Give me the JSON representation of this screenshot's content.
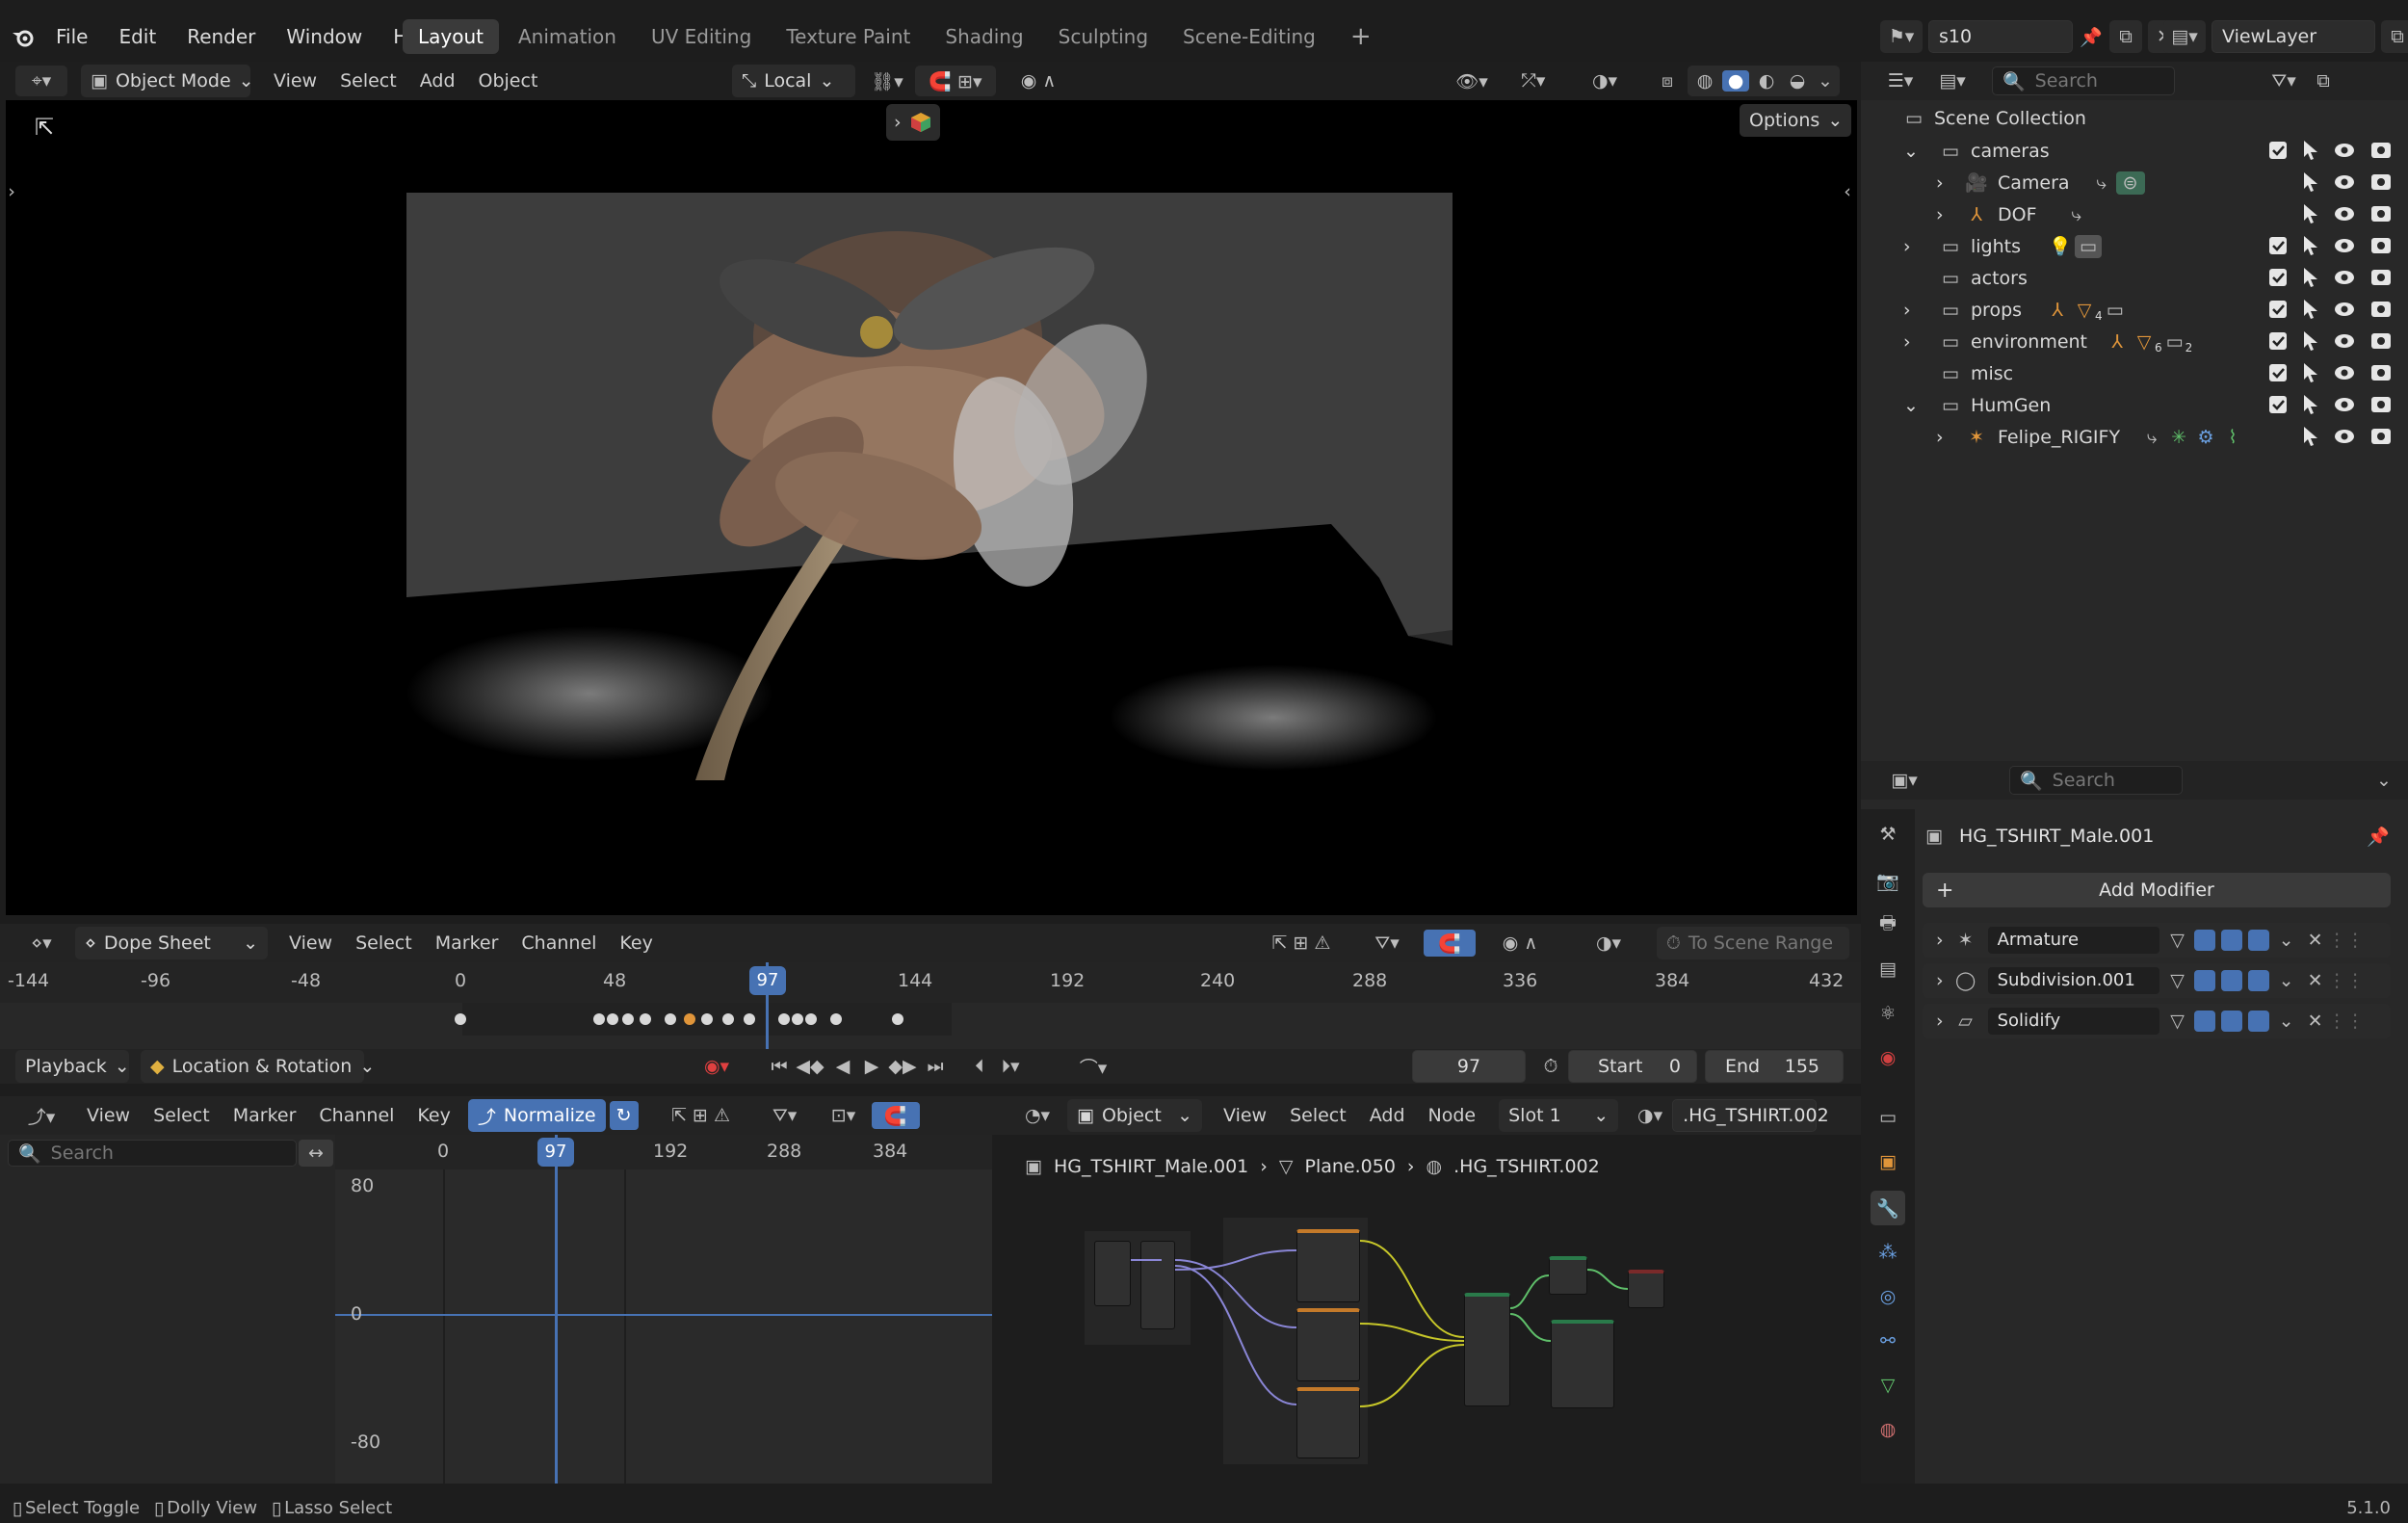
{
  "app": {
    "version": "5.1.0"
  },
  "top_menu": [
    "File",
    "Edit",
    "Render",
    "Window",
    "Help"
  ],
  "workspaces": [
    "Layout",
    "Animation",
    "UV Editing",
    "Texture Paint",
    "Shading",
    "Sculpting",
    "Scene-Editing"
  ],
  "scene": {
    "name": "s10",
    "view_layer": "ViewLayer"
  },
  "viewport": {
    "mode": "Object Mode",
    "menus": [
      "View",
      "Select",
      "Add",
      "Object"
    ],
    "transform_orientation": "Local",
    "options_label": "Options"
  },
  "outliner": {
    "search_placeholder": "Search",
    "root": "Scene Collection",
    "items": [
      {
        "label": "cameras"
      },
      {
        "label": "Camera"
      },
      {
        "label": "DOF"
      },
      {
        "label": "lights"
      },
      {
        "label": "actors"
      },
      {
        "label": "props"
      },
      {
        "label": "environment"
      },
      {
        "label": "misc"
      },
      {
        "label": "HumGen"
      },
      {
        "label": "Felipe_RIGIFY"
      }
    ],
    "badges": {
      "props_count": "4",
      "environment_count": "6",
      "environment_count2": "2"
    }
  },
  "properties": {
    "search_placeholder": "Search",
    "object_name": "HG_TSHIRT_Male.001",
    "add_modifier": "Add Modifier",
    "modifiers": [
      "Armature",
      "Subdivision.001",
      "Solidify"
    ]
  },
  "dopesheet": {
    "editor": "Dope Sheet",
    "menus": [
      "View",
      "Select",
      "Marker",
      "Channel",
      "Key"
    ],
    "scene_range": "To Scene Range",
    "ruler": [
      "-144",
      "-96",
      "-48",
      "0",
      "48",
      "97",
      "144",
      "192",
      "240",
      "288",
      "336",
      "384",
      "432"
    ],
    "current_frame_marker": "97"
  },
  "playback": {
    "playback_label": "Playback",
    "keying_set": "Location & Rotation",
    "current_frame": "97",
    "start_label": "Start",
    "start": "0",
    "end_label": "End",
    "end": "155"
  },
  "graph": {
    "menus": [
      "View",
      "Select",
      "Marker",
      "Channel",
      "Key"
    ],
    "normalize": "Normalize",
    "search_placeholder": "Search",
    "ruler": [
      "0",
      "97",
      "192",
      "288",
      "384"
    ],
    "y_labels": [
      "80",
      "0",
      "-80"
    ]
  },
  "shader": {
    "object_dd": "Object",
    "menus": [
      "View",
      "Select",
      "Add",
      "Node"
    ],
    "slot": "Slot 1",
    "material": ".HG_TSHIRT.002",
    "breadcrumb": [
      "HG_TSHIRT_Male.001",
      "Plane.050",
      ".HG_TSHIRT.002"
    ]
  },
  "statusbar": [
    "Select Toggle",
    "Dolly View",
    "Lasso Select"
  ]
}
